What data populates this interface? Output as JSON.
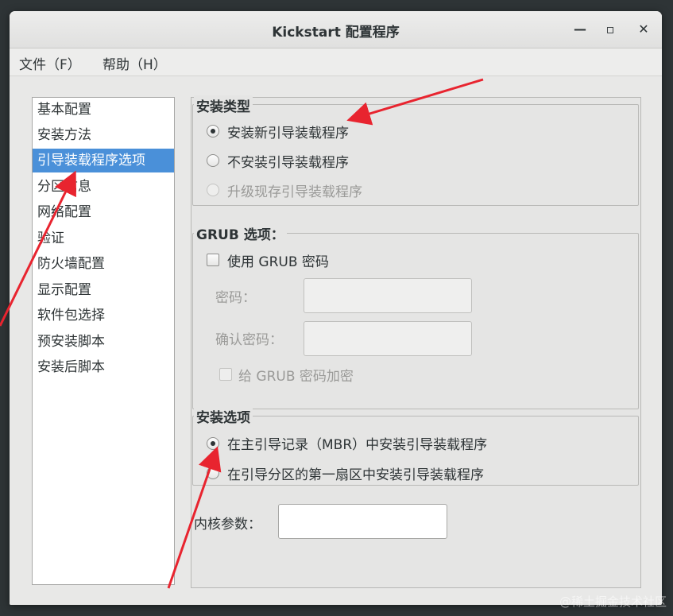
{
  "window": {
    "title": "Kickstart 配置程序"
  },
  "menu": {
    "file": "文件（F）",
    "help": "帮助（H）"
  },
  "sidebar": {
    "items": [
      {
        "label": "基本配置"
      },
      {
        "label": "安装方法"
      },
      {
        "label": "引导装载程序选项",
        "selected": true
      },
      {
        "label": "分区信息"
      },
      {
        "label": "网络配置"
      },
      {
        "label": "验证"
      },
      {
        "label": "防火墙配置"
      },
      {
        "label": "显示配置"
      },
      {
        "label": "软件包选择"
      },
      {
        "label": "预安装脚本"
      },
      {
        "label": "安装后脚本"
      }
    ]
  },
  "install_type": {
    "title": "安装类型",
    "options": [
      {
        "label": "安装新引导装载程序",
        "checked": true
      },
      {
        "label": "不安装引导装载程序",
        "checked": false
      },
      {
        "label": "升级现存引导装载程序",
        "checked": false,
        "disabled": true
      }
    ]
  },
  "grub": {
    "title": "GRUB 选项：",
    "use_password": "使用  GRUB 密码",
    "password_label": "密码：",
    "confirm_label": "确认密码：",
    "encrypt": "给  GRUB 密码加密"
  },
  "install_options": {
    "title": "安装选项",
    "options": [
      {
        "label": "在主引导记录（MBR）中安装引导装载程序",
        "checked": true
      },
      {
        "label": "在引导分区的第一扇区中安装引导装载程序",
        "checked": false
      }
    ]
  },
  "kernel": {
    "label": "内核参数：",
    "value": ""
  },
  "watermark": "@稀土掘金技术社区",
  "colors": {
    "selection": "#4a90d9",
    "annotation_arrow": "#e8242f"
  }
}
